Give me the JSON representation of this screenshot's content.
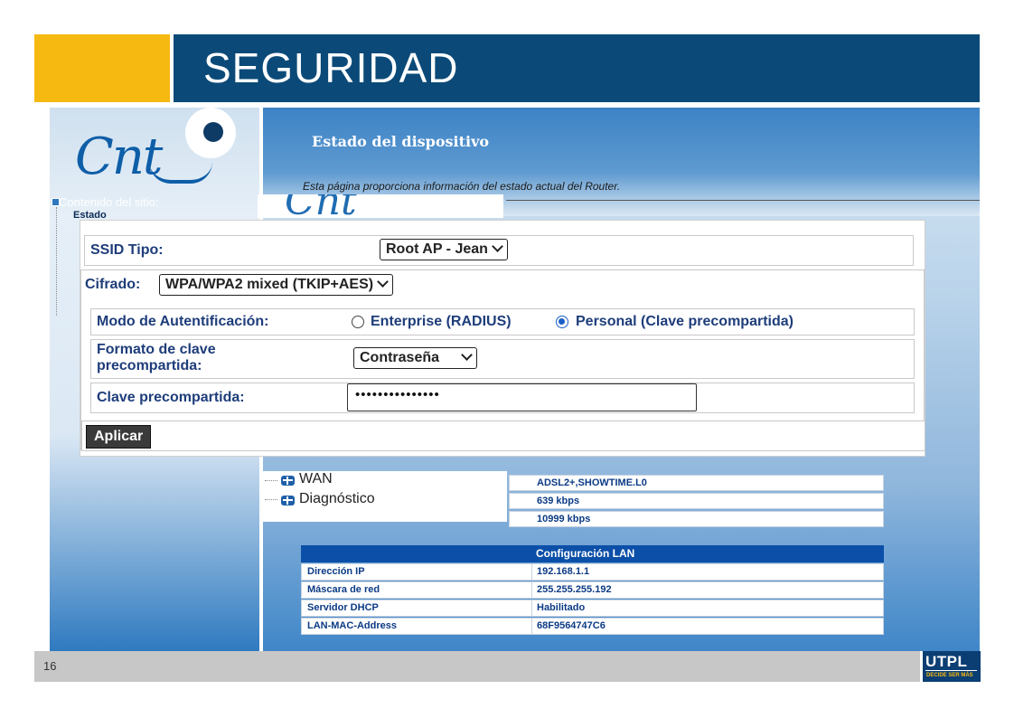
{
  "slide": {
    "title": "SEGURIDAD",
    "page_number": "16",
    "logo_text": "UTPL",
    "logo_tagline": "DECIDE SER MÁS"
  },
  "router": {
    "brand_logo": "Cnt",
    "site_content_label": "Contenido del sitio:",
    "tree_status": "Estado",
    "page_title": "Estado del dispositivo",
    "page_description": "Esta página proporciona información del estado actual del Router."
  },
  "wifi_form": {
    "ssid_type_label": "SSID Tipo:",
    "ssid_type_value": "Root AP - Jean",
    "cipher_label": "Cifrado:",
    "cipher_value": "WPA/WPA2 mixed (TKIP+AES)",
    "auth_mode_label": "Modo de Autentificación:",
    "auth_options": [
      {
        "label": "Enterprise (RADIUS)",
        "selected": false
      },
      {
        "label": "Personal (Clave precompartida)",
        "selected": true
      }
    ],
    "psk_format_label": "Formato de clave precompartida:",
    "psk_format_value": "Contraseña",
    "psk_label": "Clave precompartida:",
    "psk_value": "•••••••••••••••",
    "apply_button": "Aplicar"
  },
  "tree_lower": {
    "items": [
      "WAN",
      "Diagnóstico"
    ]
  },
  "wan_values": [
    "ADSL2+,SHOWTIME.L0",
    "639 kbps",
    "10999 kbps"
  ],
  "lan": {
    "header": "Configuración LAN",
    "rows": [
      {
        "key": "Dirección IP",
        "value": "192.168.1.1"
      },
      {
        "key": "Máscara de red",
        "value": "255.255.255.192"
      },
      {
        "key": "Servidor DHCP",
        "value": "Habilitado"
      },
      {
        "key": "LAN-MAC-Address",
        "value": "68F9564747C6"
      }
    ]
  },
  "colors": {
    "header_blue": "#0b4a78",
    "header_yellow": "#f6b912",
    "label_blue": "#1e3d7a",
    "table_header": "#0b4fa8"
  }
}
